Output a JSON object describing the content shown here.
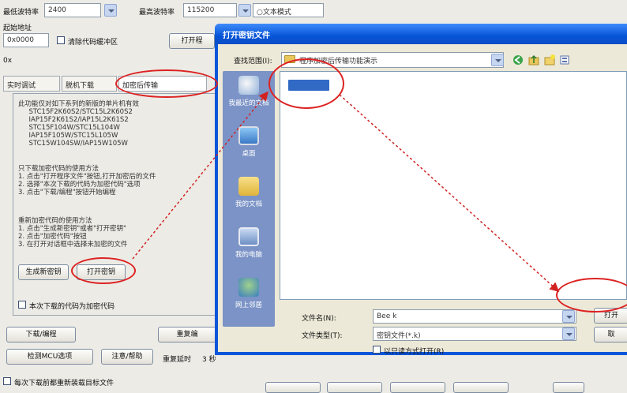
{
  "main": {
    "label_min_baud": "最低波特率",
    "min_baud": "2400",
    "label_max_baud": "最高波特率",
    "max_baud": "115200",
    "right_field": "○文本模式",
    "label_start_addr": "起始地址",
    "start_addr": "0x0000",
    "clear_buffer": "清除代码缓冲区",
    "open_button": "打开程",
    "addr2": "0x",
    "tabs": [
      "实时调试",
      "脱机下载",
      "加密后传输"
    ],
    "panel_lines": [
      "此功能仅对如下系列的新版的单片机有效",
      "     STC15F2K60S2/STC15L2K60S2",
      "     IAP15F2K61S2/IAP15L2K61S2",
      "     STC15F104W/STC15L104W",
      "     IAP15F105W/STC15L105W",
      "     STC15W104SW/IAP15W105W",
      "",
      "只下载加密代码的使用方法",
      "1. 点击\"打开程序文件\"按钮,打开加密后的文件",
      "2. 选择\"本次下载的代码为加密代码\"选项",
      "3. 点击\"下载/编程\"按钮开始编程",
      "",
      "重新加密代码的使用方法",
      "1. 点击\"生成新密钥\"或者\"打开密钥\"",
      "2. 点击\"加密代码\"按钮",
      "3. 在打开对话框中选择未加密的文件"
    ],
    "gen_key_button": "生成新密钥",
    "open_key_button": "打开密钥",
    "encrypted_check": "本次下载的代码为加密代码",
    "download_button": "下载/编程",
    "repeat_button": "重复编",
    "check_mcu_button": "检测MCU选项",
    "help_button": "注意/帮助",
    "repeat_delay_label": "重复延时",
    "repeat_delay_value": "3 秒",
    "reload_check": "每次下载前都重新装载目标文件"
  },
  "dialog": {
    "title": "打开密钥文件",
    "lookin_label": "查找范围(I):",
    "lookin_value": "程序加密后传输功能演示",
    "places": [
      "我最近的文档",
      "桌面",
      "我的文档",
      "我的电脑",
      "网上邻居"
    ],
    "filename_label": "文件名(N):",
    "filename_value": "Bee k",
    "filetype_label": "文件类型(T):",
    "filetype_value": "密钥文件(*.k)",
    "readonly_label": "以只读方式打开(R)",
    "open_button": "打开",
    "cancel_button": "取"
  },
  "colors": {
    "annotation_red": "#d22222",
    "title_blue": "#0655d7",
    "places_bar": "#7b93c6",
    "selection": "#316ac5"
  },
  "icons": [
    "folder-icon",
    "recent-docs-icon",
    "desktop-icon",
    "my-documents-icon",
    "my-computer-icon",
    "network-icon"
  ]
}
